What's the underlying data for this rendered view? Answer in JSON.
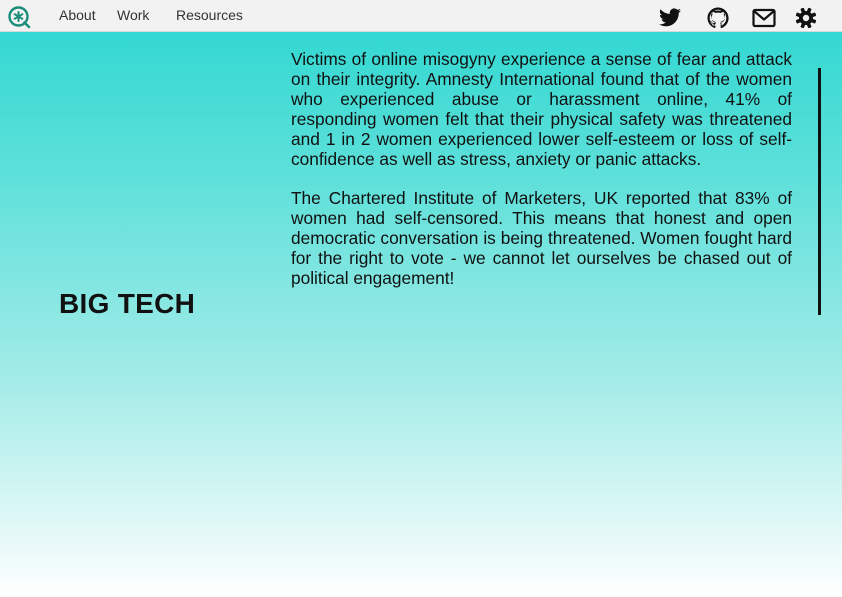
{
  "brand": {
    "logo_icon": "asterisk-chat-bubble-icon",
    "color": "#1a8c7a"
  },
  "nav": {
    "items": [
      {
        "label": "About"
      },
      {
        "label": "Work"
      },
      {
        "label": "Resources"
      }
    ]
  },
  "social": {
    "icons": [
      "twitter-icon",
      "github-icon",
      "mail-icon",
      "settings-icon"
    ]
  },
  "section": {
    "title": "BIG TECH",
    "paragraphs": [
      "Victims of online misogyny experience a sense of fear and attack on their integrity. Amnesty International found that of the women who experienced abuse or harassment online, 41% of responding women felt that their physical safety was threatened and 1 in 2 women experienced lower self-esteem or loss of self-confidence as well as stress, anxiety or panic attacks.",
      "The Chartered Institute of Marketers, UK reported that 83% of women had self-censored. This means that honest and open democratic conversation is being threatened. Women fought hard for the right to vote - we cannot let ourselves be chased out of political engagement!"
    ]
  },
  "colors": {
    "gradient_top": "#2ad6d0",
    "gradient_bottom": "#ffffff",
    "text": "#111111",
    "topbar": "#f2f2f2"
  }
}
